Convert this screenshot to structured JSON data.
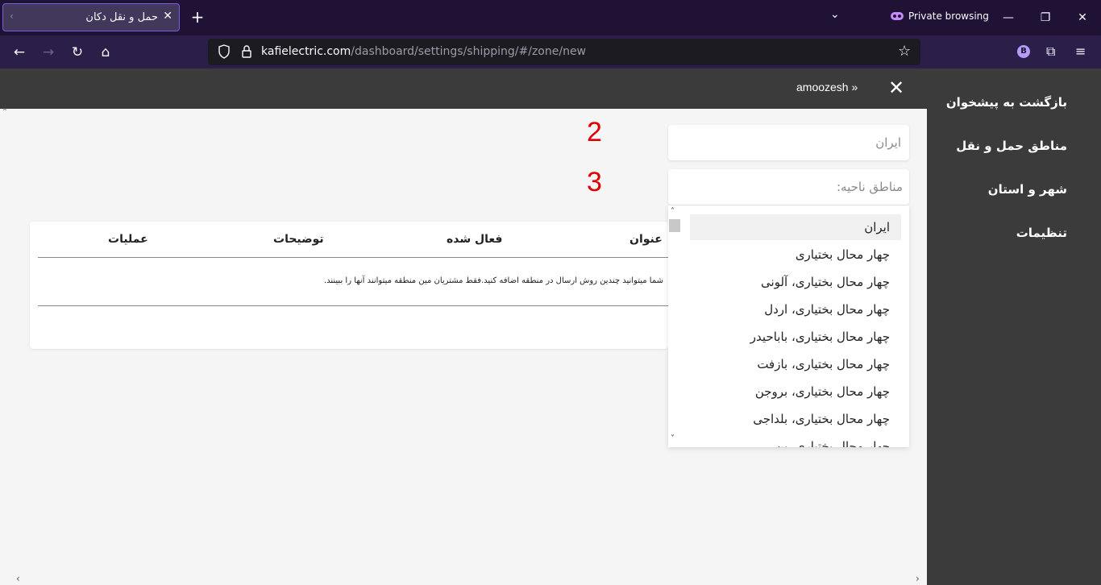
{
  "browser": {
    "tab_title": "حمل و نقل دکان",
    "private_label": "Private browsing",
    "url_host": "kafielectric.com",
    "url_path": "/dashboard/settings/shipping/#/zone/new",
    "profile_initial": "B"
  },
  "header": {
    "store_link": "amoozesh »"
  },
  "sidebar": {
    "items": [
      {
        "label": "بازگشت به پیشخوان"
      },
      {
        "label": "مناطق حمل و نقل"
      },
      {
        "label": "شهر و استان"
      },
      {
        "label": "تنظیمات"
      }
    ]
  },
  "annotations": {
    "two": "2",
    "three": "3"
  },
  "form": {
    "zone_name_value": "ایران",
    "regions_placeholder": "مناطق ناحیه:"
  },
  "dropdown": {
    "options": [
      {
        "label": "ایران",
        "selected": true
      },
      {
        "label": "چهار محال بختیاری"
      },
      {
        "label": "چهار محال بختیاری، آلونی"
      },
      {
        "label": "چهار محال بختیاری، اردل"
      },
      {
        "label": "چهار محال بختیاری، باباحیدر"
      },
      {
        "label": "چهار محال بختیاری، بازفت"
      },
      {
        "label": "چهار محال بختیاری، بروجن"
      },
      {
        "label": "چهار محال بختیاری، بلداجی"
      },
      {
        "label": "چهار محال بختیاری، بن"
      }
    ]
  },
  "table": {
    "headers": {
      "title": "عنوان",
      "enabled": "فعال شده",
      "description": "توضیحات",
      "actions": "عملیات"
    },
    "hint": "شما میتوانید چندین روش ارسال در منطقه اضافه کنید.فقط مشتریان مین منطقه میتوانند آنها را ببینند."
  }
}
